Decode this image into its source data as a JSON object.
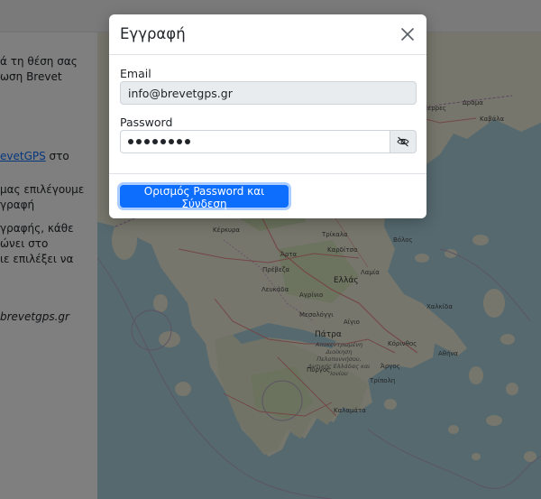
{
  "background": {
    "left_text": {
      "line1": "ά τη θέση σας",
      "line2": "ωση Brevet",
      "link": "evetGPS",
      "link_suffix": " στο",
      "line4": "μας επιλέγουμε",
      "line5": "γραφή",
      "line6": "γραφής, κάθε",
      "line7": "ώνει στο",
      "line8": "ιε επιλέξει να",
      "email_frag": "brevetgps.gr"
    },
    "map_labels": {
      "serres": "Σέρρες",
      "drama": "Δράμα",
      "kavala": "Καβάλα",
      "kerkyra": "Κέρκυρα",
      "trikala": "Τρίκαλα",
      "karditsa": "Καρδίτσα",
      "volos": "Βόλος",
      "arta": "Άρτα",
      "preveza": "Πρέβεζα",
      "lamia": "Λαμία",
      "lefkada": "Λευκάδα",
      "agrinio": "Αγρίνιο",
      "ellas": "Ελλάς",
      "chalkida": "Χαλκίδα",
      "mesolongi": "Μεσολόγγι",
      "aigio": "Αίγιο",
      "patra": "Πάτρα",
      "region": "Αποκεντρωμένη Διοίκηση Πελοποννήσου, Δυτικής Ελλάδας και Ιονίου",
      "korinthos": "Κόρινθος",
      "athina": "Αθήνα",
      "pyrgos": "Πύργος",
      "argos": "Άργος",
      "tripoli": "Τρίπολη",
      "kalamata": "Καλαμάτα"
    }
  },
  "modal": {
    "title": "Εγγραφή",
    "email_label": "Email",
    "email_value": "info@brevetgps.gr",
    "password_label": "Password",
    "password_masked": "••••••••",
    "submit_label": "Ορισμός Password και Σύνδεση"
  },
  "colors": {
    "primary": "#0d6efd",
    "readonly_bg": "#e9ecef",
    "border": "#ced4da"
  },
  "icons": {
    "close": "close-icon",
    "toggle_password": "eye-slash-icon"
  }
}
